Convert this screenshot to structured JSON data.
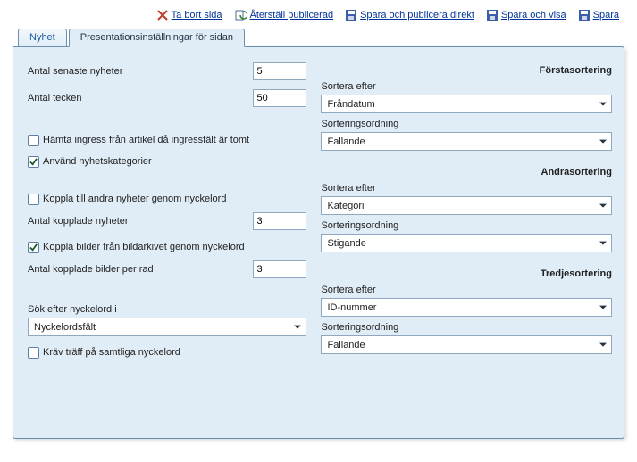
{
  "toolbar": {
    "delete_page": "Ta bort sida",
    "restore_published": "Återställ publicerad",
    "save_publish_direct": "Spara och publicera direkt",
    "save_and_show": "Spara och visa",
    "save": "Spara"
  },
  "tabs": {
    "news": "Nyhet",
    "presentation_settings": "Presentationsinställningar för sidan"
  },
  "left": {
    "latest_news_count_label": "Antal senaste nyheter",
    "latest_news_count_value": "5",
    "char_count_label": "Antal tecken",
    "char_count_value": "50",
    "fetch_ingress_label": "Hämta ingress från artikel då ingressfält är tomt",
    "fetch_ingress_checked": false,
    "use_categories_label": "Använd nyhetskategorier",
    "use_categories_checked": true,
    "link_keywords_label": "Koppla till andra nyheter genom nyckelord",
    "link_keywords_checked": false,
    "linked_news_count_label": "Antal kopplade nyheter",
    "linked_news_count_value": "3",
    "link_images_label": "Koppla bilder från bildarkivet genom nyckelord",
    "link_images_checked": true,
    "linked_images_per_row_label": "Antal kopplade bilder per rad",
    "linked_images_per_row_value": "3",
    "search_keywords_label": "Sök efter nyckelord i",
    "search_keywords_value": "Nyckelordsfält",
    "require_all_label": "Kräv träff på samtliga nyckelord",
    "require_all_checked": false
  },
  "right": {
    "sort1_heading": "Förstasortering",
    "sort2_heading": "Andrasortering",
    "sort3_heading": "Tredjesortering",
    "sort_by_label": "Sortera efter",
    "sort_order_label": "Sorteringsordning",
    "sort1_by": "Fråndatum",
    "sort1_order": "Fallande",
    "sort2_by": "Kategori",
    "sort2_order": "Stigande",
    "sort3_by": "ID-nummer",
    "sort3_order": "Fallande"
  }
}
